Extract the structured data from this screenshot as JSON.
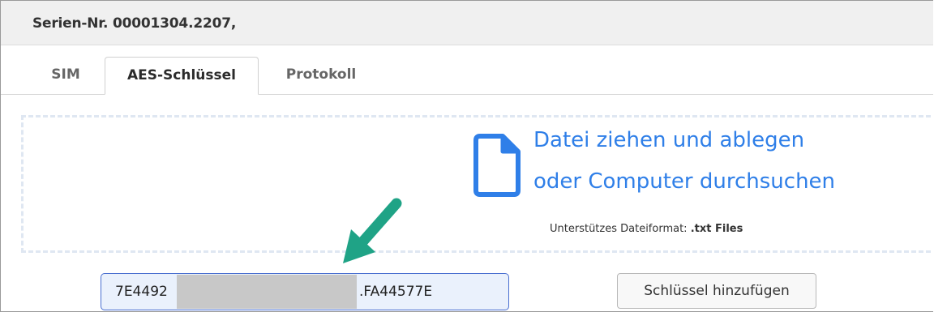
{
  "header": {
    "title": "Serien-Nr. 00001304.2207,"
  },
  "tabs": [
    {
      "label": "SIM",
      "active": false
    },
    {
      "label": "AES-Schlüssel",
      "active": true
    },
    {
      "label": "Protokoll",
      "active": false
    }
  ],
  "dropzone": {
    "line1": "Datei ziehen und ablegen",
    "line2": "oder Computer durchsuchen",
    "format_label": "Unterstützes Dateiformat:",
    "format_value": ".txt Files",
    "icon": "file-icon"
  },
  "key_input": {
    "value_prefix": "7E4492",
    "value_suffix": ".FA44577E",
    "redacted": true
  },
  "add_button": {
    "label": "Schlüssel hinzufügen"
  },
  "colors": {
    "accent": "#2f7fe8",
    "arrow": "#1fa386",
    "input_bg": "#eaf1fc"
  }
}
